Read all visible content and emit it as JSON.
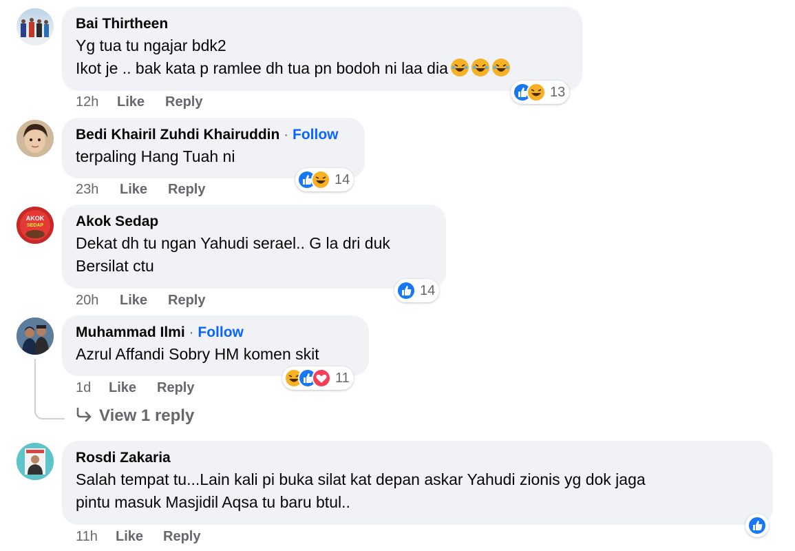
{
  "actions": {
    "like": "Like",
    "reply": "Reply",
    "follow": "Follow",
    "dot": "·"
  },
  "colors": {
    "link": "#0866ff",
    "bubble": "#f0f2f5",
    "meta": "#65676b",
    "like": "#1877f2",
    "haha": "#f7b125",
    "love": "#f33e58"
  },
  "comments": [
    {
      "author": "Bai Thirtheen",
      "lines": [
        "Yg tua tu ngajar bdk2",
        "Ikot je .. bak kata p ramlee dh tua pn bodoh ni laa dia"
      ],
      "inline_emojis": [
        "haha-emoji",
        "haha-emoji",
        "haha-emoji"
      ],
      "time": "12h",
      "reactions": [
        "like",
        "haha"
      ],
      "reaction_count": "13"
    },
    {
      "author": "Bedi Khairil Zuhdi Khairuddin",
      "follow": true,
      "lines": [
        "terpaling Hang Tuah ni"
      ],
      "time": "23h",
      "reactions": [
        "like",
        "haha"
      ],
      "reaction_count": "14"
    },
    {
      "author": "Akok Sedap",
      "lines": [
        "Dekat dh tu ngan Yahudi serael.. G la dri duk",
        "Bersilat ctu"
      ],
      "time": "20h",
      "reactions": [
        "like"
      ],
      "reaction_count": "14",
      "avatar_text": "AKOK SEDAP"
    },
    {
      "author": "Muhammad Ilmi",
      "follow": true,
      "lines": [
        "Azrul Affandi Sobry HM komen skit"
      ],
      "time": "1d",
      "reactions": [
        "haha",
        "like",
        "love"
      ],
      "reaction_count": "11",
      "view_replies": "View 1 reply"
    },
    {
      "author": "Rosdi Zakaria",
      "lines": [
        "Salah tempat tu...Lain kali pi buka silat kat depan askar Yahudi zionis yg dok jaga",
        "pintu masuk Masjidil Aqsa tu baru btul.."
      ],
      "time": "11h",
      "reactions": [
        "like"
      ],
      "reaction_count": ""
    }
  ]
}
